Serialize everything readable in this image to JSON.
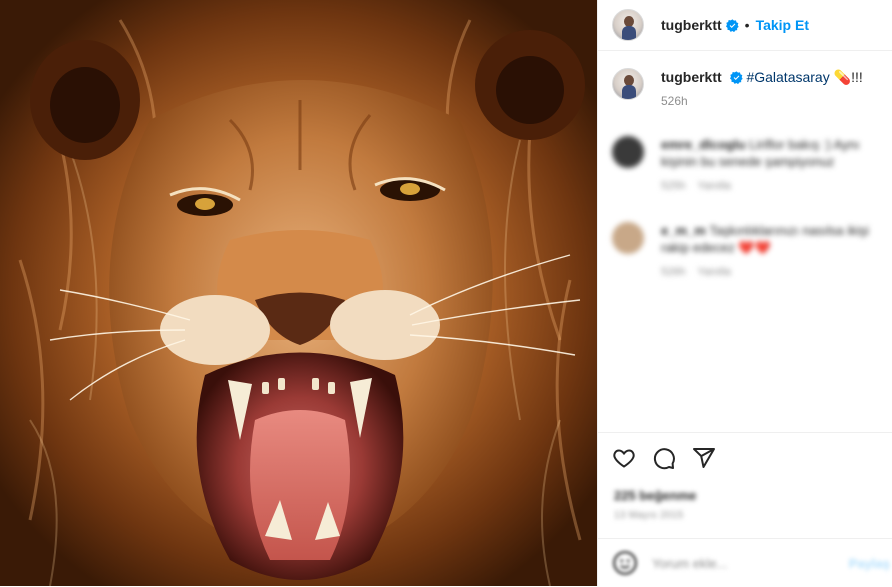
{
  "post": {
    "username": "tugberktt",
    "separator": "•",
    "follow_label": "Takip Et",
    "caption": {
      "hashtag": "#Galatasaray",
      "emoji": "💊",
      "suffix": "!!!",
      "time": "526h"
    },
    "comments": [
      {
        "username": "emre_dlcoglu",
        "text": "Liriflor bakış :) Aynı kişinin bu senede şampiyonuz",
        "time": "525h",
        "reply_label": "Yanıtla",
        "avatar_color": "#3a3a3a"
      },
      {
        "username": "e_m_m",
        "text": "Taşkınlıklarınızı nasılsa ikişi rakip edecez",
        "hearts": "❤️❤️",
        "time": "526h",
        "reply_label": "Yanıtla",
        "avatar_color": "#c8a888"
      }
    ],
    "likes": "225 beğenme",
    "date": "13 Mayıs 2015",
    "add_comment_placeholder": "Yorum ekle...",
    "post_button": "Paylaş"
  },
  "icons": {
    "like": "heart-icon",
    "comment": "comment-icon",
    "share": "share-icon",
    "emoji": "emoji-icon",
    "verified": "verified-badge-icon"
  },
  "colors": {
    "link_blue": "#0095f6",
    "hashtag": "#00376b",
    "muted": "#8e8e8e",
    "border": "#efefef"
  }
}
